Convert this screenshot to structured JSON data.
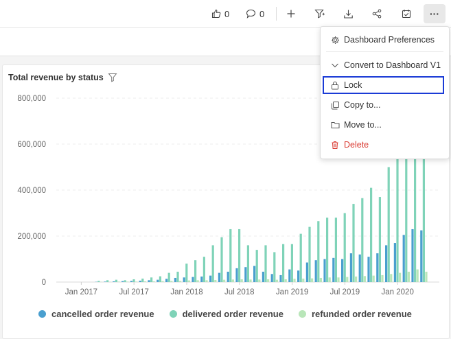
{
  "toolbar": {
    "like_count": "0",
    "comment_count": "0",
    "icons": [
      "thumbs-up-icon",
      "comment-icon",
      "plus-icon",
      "filter-icon",
      "download-icon",
      "share-icon",
      "schedule-icon",
      "more-icon"
    ],
    "more_label": "···"
  },
  "card": {
    "title": "Total revenue by status"
  },
  "menu": {
    "items": [
      {
        "label": "Dashboard Preferences",
        "icon": "gear-icon"
      },
      {
        "label": "Convert to Dashboard V1",
        "icon": "chevron-down-icon"
      },
      {
        "label": "Lock",
        "icon": "lock-icon"
      },
      {
        "label": "Copy to...",
        "icon": "copy-icon"
      },
      {
        "label": "Move to...",
        "icon": "folder-icon"
      },
      {
        "label": "Delete",
        "icon": "trash-icon"
      }
    ],
    "focused_item": "Lock",
    "delete_color": "#d9382f"
  },
  "chart_data": {
    "type": "bar",
    "title": "Total revenue by status",
    "ylim": [
      0,
      800000
    ],
    "yticks": [
      "0",
      "200,000",
      "400,000",
      "600,000",
      "800,000"
    ],
    "xtick_labels": [
      "Jan 2017",
      "Jul 2017",
      "Jan 2018",
      "Jul 2018",
      "Jan 2019",
      "Jul 2019",
      "Jan 2020"
    ],
    "categories": [
      "2016-09",
      "2016-10",
      "2016-11",
      "2016-12",
      "2017-01",
      "2017-02",
      "2017-03",
      "2017-04",
      "2017-05",
      "2017-06",
      "2017-07",
      "2017-08",
      "2017-09",
      "2017-10",
      "2017-11",
      "2017-12",
      "2018-01",
      "2018-02",
      "2018-03",
      "2018-04",
      "2018-05",
      "2018-06",
      "2018-07",
      "2018-08",
      "2018-09",
      "2018-10",
      "2018-11",
      "2018-12",
      "2019-01",
      "2019-02",
      "2019-03",
      "2019-04",
      "2019-05",
      "2019-06",
      "2019-07",
      "2019-08",
      "2019-09",
      "2019-10",
      "2019-11",
      "2019-12",
      "2020-01",
      "2020-02",
      "2020-03",
      "2020-04"
    ],
    "series": [
      {
        "name": "cancelled order revenue",
        "color": "#4a9fcf",
        "values": [
          0,
          0,
          0,
          0,
          0,
          0,
          1000,
          2000,
          3000,
          4000,
          5000,
          6000,
          8000,
          10000,
          14000,
          18000,
          20000,
          22000,
          24000,
          28000,
          40000,
          45000,
          60000,
          65000,
          70000,
          45000,
          35000,
          30000,
          55000,
          50000,
          85000,
          95000,
          100000,
          105000,
          100000,
          125000,
          120000,
          110000,
          125000,
          160000,
          170000,
          205000,
          230000,
          225000
        ]
      },
      {
        "name": "delivered order revenue",
        "color": "#7fd3b8",
        "values": [
          0,
          0,
          0,
          0,
          0,
          0,
          5000,
          8000,
          10000,
          8000,
          12000,
          15000,
          20000,
          25000,
          40000,
          45000,
          80000,
          95000,
          110000,
          160000,
          195000,
          230000,
          230000,
          160000,
          140000,
          160000,
          130000,
          165000,
          165000,
          210000,
          240000,
          265000,
          280000,
          280000,
          300000,
          340000,
          365000,
          410000,
          370000,
          500000,
          570000,
          600000,
          620000,
          640000
        ]
      },
      {
        "name": "refunded order revenue",
        "color": "#b9e6b9",
        "values": [
          0,
          0,
          0,
          0,
          0,
          0,
          1000,
          1000,
          2000,
          2000,
          2000,
          3000,
          3000,
          4000,
          5000,
          5000,
          7000,
          8000,
          8000,
          9000,
          10000,
          11000,
          12000,
          11000,
          11000,
          12000,
          10000,
          12000,
          14000,
          15000,
          16000,
          18000,
          20000,
          20000,
          22000,
          24000,
          26000,
          28000,
          30000,
          35000,
          40000,
          45000,
          55000,
          45000
        ]
      }
    ],
    "legend_position": "bottom",
    "grid": true
  }
}
